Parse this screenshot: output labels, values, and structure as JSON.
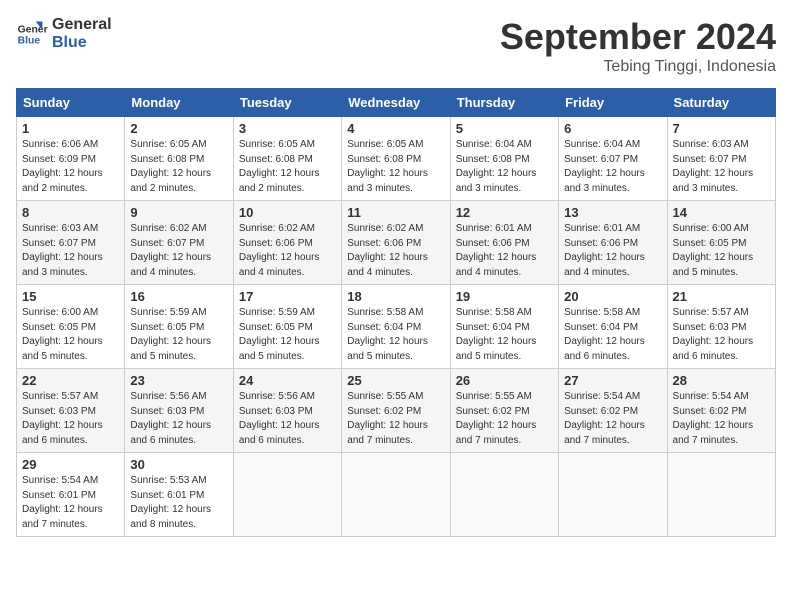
{
  "header": {
    "logo_line1": "General",
    "logo_line2": "Blue",
    "month": "September 2024",
    "location": "Tebing Tinggi, Indonesia"
  },
  "weekdays": [
    "Sunday",
    "Monday",
    "Tuesday",
    "Wednesday",
    "Thursday",
    "Friday",
    "Saturday"
  ],
  "weeks": [
    [
      {
        "day": "1",
        "info": "Sunrise: 6:06 AM\nSunset: 6:09 PM\nDaylight: 12 hours\nand 2 minutes."
      },
      {
        "day": "2",
        "info": "Sunrise: 6:05 AM\nSunset: 6:08 PM\nDaylight: 12 hours\nand 2 minutes."
      },
      {
        "day": "3",
        "info": "Sunrise: 6:05 AM\nSunset: 6:08 PM\nDaylight: 12 hours\nand 2 minutes."
      },
      {
        "day": "4",
        "info": "Sunrise: 6:05 AM\nSunset: 6:08 PM\nDaylight: 12 hours\nand 3 minutes."
      },
      {
        "day": "5",
        "info": "Sunrise: 6:04 AM\nSunset: 6:08 PM\nDaylight: 12 hours\nand 3 minutes."
      },
      {
        "day": "6",
        "info": "Sunrise: 6:04 AM\nSunset: 6:07 PM\nDaylight: 12 hours\nand 3 minutes."
      },
      {
        "day": "7",
        "info": "Sunrise: 6:03 AM\nSunset: 6:07 PM\nDaylight: 12 hours\nand 3 minutes."
      }
    ],
    [
      {
        "day": "8",
        "info": "Sunrise: 6:03 AM\nSunset: 6:07 PM\nDaylight: 12 hours\nand 3 minutes."
      },
      {
        "day": "9",
        "info": "Sunrise: 6:02 AM\nSunset: 6:07 PM\nDaylight: 12 hours\nand 4 minutes."
      },
      {
        "day": "10",
        "info": "Sunrise: 6:02 AM\nSunset: 6:06 PM\nDaylight: 12 hours\nand 4 minutes."
      },
      {
        "day": "11",
        "info": "Sunrise: 6:02 AM\nSunset: 6:06 PM\nDaylight: 12 hours\nand 4 minutes."
      },
      {
        "day": "12",
        "info": "Sunrise: 6:01 AM\nSunset: 6:06 PM\nDaylight: 12 hours\nand 4 minutes."
      },
      {
        "day": "13",
        "info": "Sunrise: 6:01 AM\nSunset: 6:06 PM\nDaylight: 12 hours\nand 4 minutes."
      },
      {
        "day": "14",
        "info": "Sunrise: 6:00 AM\nSunset: 6:05 PM\nDaylight: 12 hours\nand 5 minutes."
      }
    ],
    [
      {
        "day": "15",
        "info": "Sunrise: 6:00 AM\nSunset: 6:05 PM\nDaylight: 12 hours\nand 5 minutes."
      },
      {
        "day": "16",
        "info": "Sunrise: 5:59 AM\nSunset: 6:05 PM\nDaylight: 12 hours\nand 5 minutes."
      },
      {
        "day": "17",
        "info": "Sunrise: 5:59 AM\nSunset: 6:05 PM\nDaylight: 12 hours\nand 5 minutes."
      },
      {
        "day": "18",
        "info": "Sunrise: 5:58 AM\nSunset: 6:04 PM\nDaylight: 12 hours\nand 5 minutes."
      },
      {
        "day": "19",
        "info": "Sunrise: 5:58 AM\nSunset: 6:04 PM\nDaylight: 12 hours\nand 5 minutes."
      },
      {
        "day": "20",
        "info": "Sunrise: 5:58 AM\nSunset: 6:04 PM\nDaylight: 12 hours\nand 6 minutes."
      },
      {
        "day": "21",
        "info": "Sunrise: 5:57 AM\nSunset: 6:03 PM\nDaylight: 12 hours\nand 6 minutes."
      }
    ],
    [
      {
        "day": "22",
        "info": "Sunrise: 5:57 AM\nSunset: 6:03 PM\nDaylight: 12 hours\nand 6 minutes."
      },
      {
        "day": "23",
        "info": "Sunrise: 5:56 AM\nSunset: 6:03 PM\nDaylight: 12 hours\nand 6 minutes."
      },
      {
        "day": "24",
        "info": "Sunrise: 5:56 AM\nSunset: 6:03 PM\nDaylight: 12 hours\nand 6 minutes."
      },
      {
        "day": "25",
        "info": "Sunrise: 5:55 AM\nSunset: 6:02 PM\nDaylight: 12 hours\nand 7 minutes."
      },
      {
        "day": "26",
        "info": "Sunrise: 5:55 AM\nSunset: 6:02 PM\nDaylight: 12 hours\nand 7 minutes."
      },
      {
        "day": "27",
        "info": "Sunrise: 5:54 AM\nSunset: 6:02 PM\nDaylight: 12 hours\nand 7 minutes."
      },
      {
        "day": "28",
        "info": "Sunrise: 5:54 AM\nSunset: 6:02 PM\nDaylight: 12 hours\nand 7 minutes."
      }
    ],
    [
      {
        "day": "29",
        "info": "Sunrise: 5:54 AM\nSunset: 6:01 PM\nDaylight: 12 hours\nand 7 minutes."
      },
      {
        "day": "30",
        "info": "Sunrise: 5:53 AM\nSunset: 6:01 PM\nDaylight: 12 hours\nand 8 minutes."
      },
      null,
      null,
      null,
      null,
      null
    ]
  ]
}
